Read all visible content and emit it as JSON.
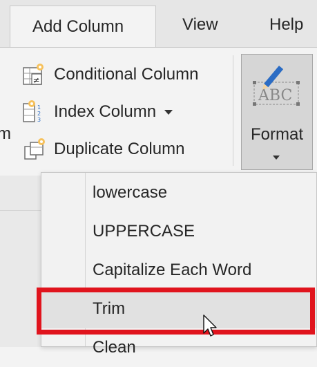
{
  "tabs": [
    {
      "label": "Add Column",
      "active": true
    },
    {
      "label": "View"
    },
    {
      "label": "Help"
    }
  ],
  "ribbon": {
    "partial_label": "m",
    "commands": [
      {
        "label": "Conditional Column",
        "icon": "conditional-column-icon"
      },
      {
        "label": "Index Column",
        "icon": "index-column-icon",
        "has_dropdown": true
      },
      {
        "label": "Duplicate Column",
        "icon": "duplicate-column-icon"
      }
    ],
    "format": {
      "label": "Format",
      "icon": "format-abc-icon",
      "icon_text": "ABC"
    }
  },
  "menu": {
    "items": [
      {
        "label": "lowercase"
      },
      {
        "label": "UPPERCASE"
      },
      {
        "label": "Capitalize Each Word"
      },
      {
        "label": "Trim",
        "hovered": true,
        "highlighted": true
      },
      {
        "label": "Clean"
      }
    ]
  },
  "colors": {
    "highlight": "#e0141d",
    "accent": "#2b6cc4"
  }
}
